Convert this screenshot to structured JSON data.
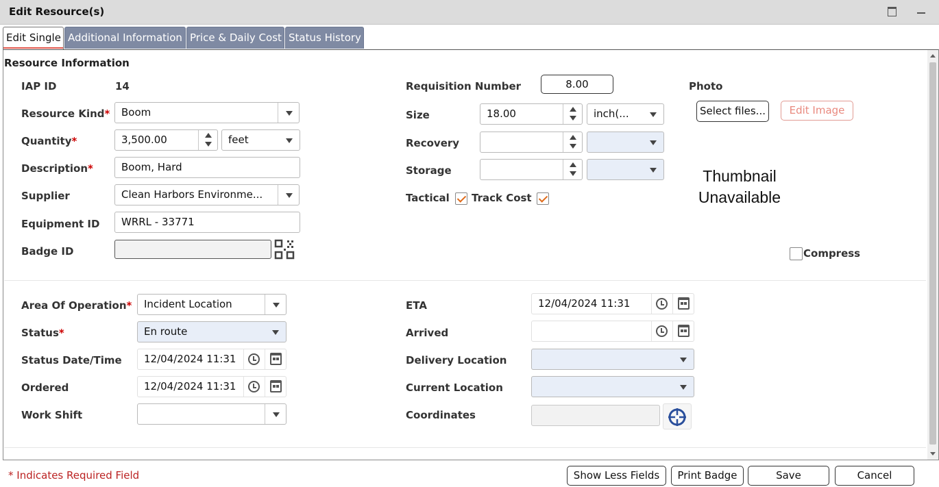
{
  "window": {
    "title": "Edit Resource(s)"
  },
  "tabs": [
    {
      "label": "Edit Single",
      "active": true
    },
    {
      "label": "Additional Information",
      "active": false
    },
    {
      "label": "Price & Daily Cost",
      "active": false
    },
    {
      "label": "Status History",
      "active": false
    }
  ],
  "resource_info": {
    "heading": "Resource Information",
    "iap_id": {
      "label": "IAP ID",
      "value": "14"
    },
    "resource_kind": {
      "label": "Resource Kind",
      "value": "Boom"
    },
    "quantity": {
      "label": "Quantity",
      "value": "3,500.00",
      "unit": "feet"
    },
    "description": {
      "label": "Description",
      "value": "Boom, Hard"
    },
    "supplier": {
      "label": "Supplier",
      "value": "Clean Harbors Environme..."
    },
    "equipment_id": {
      "label": "Equipment ID",
      "value": "WRRL - 33771"
    },
    "badge_id": {
      "label": "Badge ID",
      "value": ""
    },
    "requisition_number": {
      "label": "Requisition Number",
      "value": "8.00"
    },
    "size": {
      "label": "Size",
      "value": "18.00",
      "unit": "inch(..."
    },
    "recovery": {
      "label": "Recovery",
      "value": "",
      "unit": ""
    },
    "storage": {
      "label": "Storage",
      "value": "",
      "unit": ""
    },
    "tactical": {
      "label": "Tactical",
      "checked": true
    },
    "track_cost": {
      "label": "Track Cost",
      "checked": true
    },
    "photo": {
      "label": "Photo",
      "select_files_label": "Select files...",
      "edit_image_label": "Edit Image",
      "thumbnail_line1": "Thumbnail",
      "thumbnail_line2": "Unavailable",
      "compress_label": "Compress",
      "compress_checked": false
    }
  },
  "operation": {
    "area_of_operation": {
      "label": "Area Of Operation",
      "value": "Incident Location"
    },
    "status": {
      "label": "Status",
      "value": "En route"
    },
    "status_datetime": {
      "label": "Status Date/Time",
      "value": "12/04/2024 11:31"
    },
    "ordered": {
      "label": "Ordered",
      "value": "12/04/2024 11:31"
    },
    "work_shift": {
      "label": "Work Shift",
      "value": ""
    },
    "eta": {
      "label": "ETA",
      "value": "12/04/2024 11:31"
    },
    "arrived": {
      "label": "Arrived",
      "value": ""
    },
    "delivery_location": {
      "label": "Delivery Location",
      "value": ""
    },
    "current_location": {
      "label": "Current Location",
      "value": ""
    },
    "coordinates": {
      "label": "Coordinates",
      "value": ""
    }
  },
  "required_marker": "*",
  "footer": {
    "required_note": "* Indicates Required Field",
    "show_less_label": "Show Less Fields",
    "print_badge_label": "Print Badge",
    "save_label": "Save",
    "cancel_label": "Cancel"
  }
}
